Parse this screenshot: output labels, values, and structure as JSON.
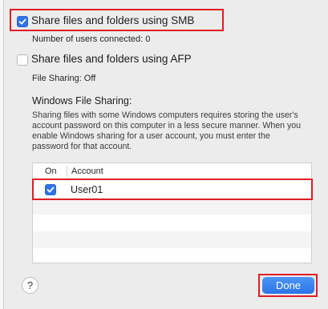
{
  "smb": {
    "label": "Share files and folders using SMB",
    "checked": true,
    "status": "Number of users connected: 0"
  },
  "afp": {
    "label": "Share files and folders using AFP",
    "checked": false,
    "status": "File Sharing: Off"
  },
  "windows": {
    "title": "Windows File Sharing:",
    "description": "Sharing files with some Windows computers requires storing the user's account password on this computer in a less secure manner.  When you enable Windows sharing for a user account, you must enter the password for that account."
  },
  "table": {
    "columns": [
      "On",
      "Account"
    ],
    "rows": [
      {
        "account": "User01",
        "on": true
      }
    ]
  },
  "buttons": {
    "help_glyph": "?",
    "done_label": "Done"
  },
  "colors": {
    "accent": "#2f73e6",
    "highlight": "#e01d25"
  }
}
